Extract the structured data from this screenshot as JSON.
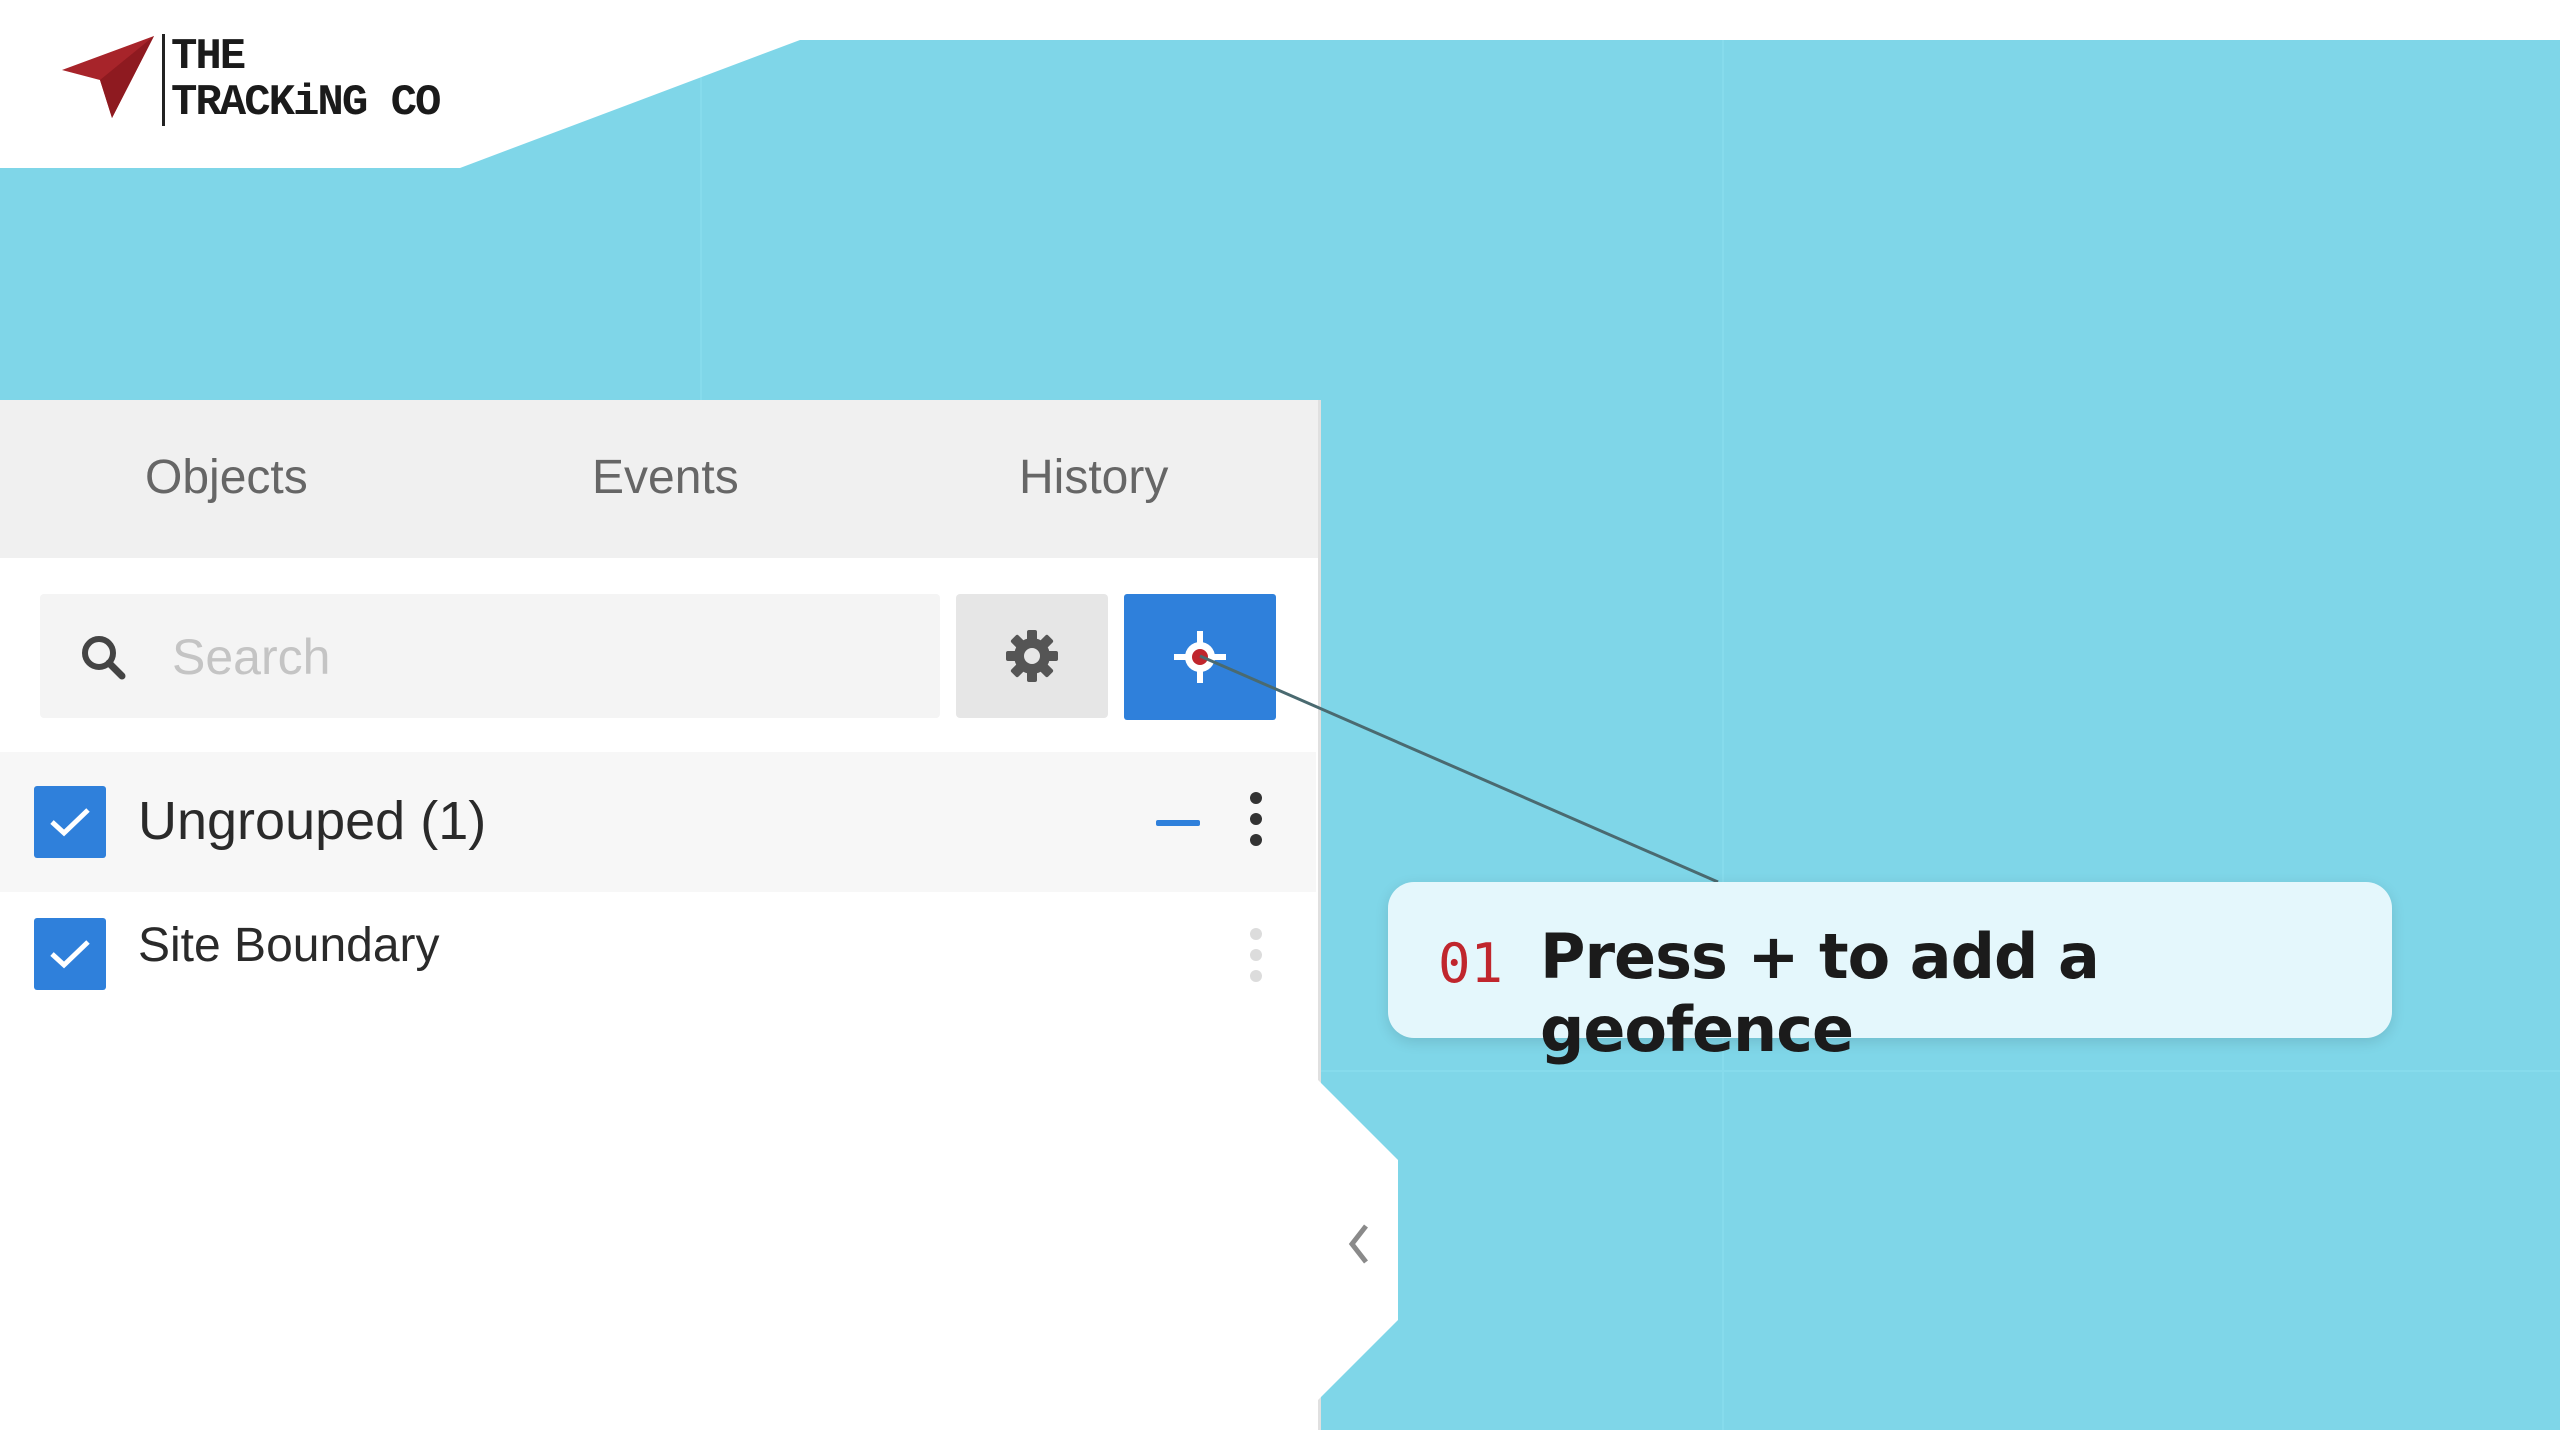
{
  "brand": {
    "line1": "THE",
    "line2": "TRACKiNG CO",
    "colors": {
      "mark": "#c0262d",
      "text": "#1a1a1a"
    }
  },
  "map": {
    "background_color": "#7fd6e8"
  },
  "tabs": [
    {
      "label": "Objects"
    },
    {
      "label": "Events"
    },
    {
      "label": "History"
    }
  ],
  "search": {
    "placeholder": "Search",
    "value": "",
    "icon": "search-icon"
  },
  "toolbar": {
    "settings_icon": "gear-icon",
    "add_geofence_icon": "crosshair-icon",
    "accent_color": "#2f80db"
  },
  "groups": [
    {
      "label": "Ungrouped (1)",
      "checked": true,
      "items": [
        {
          "label": "Site Boundary",
          "checked": true
        }
      ]
    }
  ],
  "callout": {
    "step": "01",
    "text": "Press + to add a geofence",
    "step_color": "#c0262d"
  },
  "collapse_icon": "chevron-left-icon"
}
